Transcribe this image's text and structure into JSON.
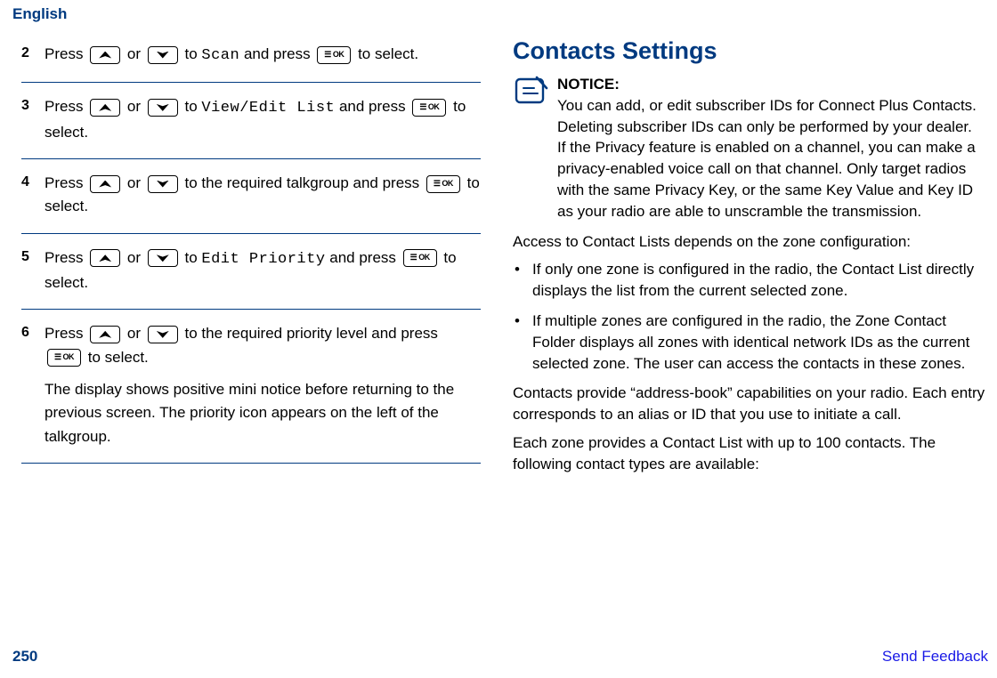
{
  "header": {
    "language": "English"
  },
  "steps": [
    {
      "num": "2",
      "pre": "Press ",
      "mid": " or ",
      "post1": " to ",
      "code": "Scan",
      "post2": " and press ",
      "tail": " to select."
    },
    {
      "num": "3",
      "pre": "Press ",
      "mid": " or ",
      "post1": " to ",
      "code": "View/Edit List",
      "post2": " and press ",
      "tail": " to select."
    },
    {
      "num": "4",
      "pre": "Press ",
      "mid": " or ",
      "post1": " to the required talkgroup and press ",
      "code": "",
      "post2": "",
      "tail": " to select."
    },
    {
      "num": "5",
      "pre": "Press ",
      "mid": " or ",
      "post1": " to ",
      "code": "Edit Priority",
      "post2": " and press ",
      "tail": " to select."
    },
    {
      "num": "6",
      "pre": "Press ",
      "mid": " or ",
      "post1": " to the required priority level and press ",
      "code": "",
      "post2": "",
      "tail": " to select.",
      "note": "The display shows positive mini notice before returning to the previous screen. The priority icon appears on the left of the talkgroup."
    }
  ],
  "ok_label": "OK",
  "right": {
    "title": "Contacts Settings",
    "notice_label": "NOTICE:",
    "notice_p1": "You can add, or edit subscriber IDs for Connect Plus Contacts. Deleting subscriber IDs can only be performed by your dealer.",
    "notice_p2": "If the Privacy feature is enabled on a channel, you can make a privacy-enabled voice call on that channel. Only target radios with the same Privacy Key, or the same Key Value and Key ID as your radio are able to unscramble the transmission.",
    "para1": "Access to Contact Lists depends on the zone configuration:",
    "bullets": [
      "If only one zone is configured in the radio, the Contact List directly displays the list from the current selected zone.",
      "If multiple zones are configured in the radio, the Zone Contact Folder displays all zones with identical network IDs as the current selected zone. The user can access the contacts in these zones."
    ],
    "para2": "Contacts provide “address-book” capabilities on your radio. Each entry corresponds to an alias or ID that you use to initiate a call.",
    "para3": "Each zone provides a Contact List with up to 100 contacts. The following contact types are available:"
  },
  "footer": {
    "page": "250",
    "feedback": "Send Feedback"
  }
}
